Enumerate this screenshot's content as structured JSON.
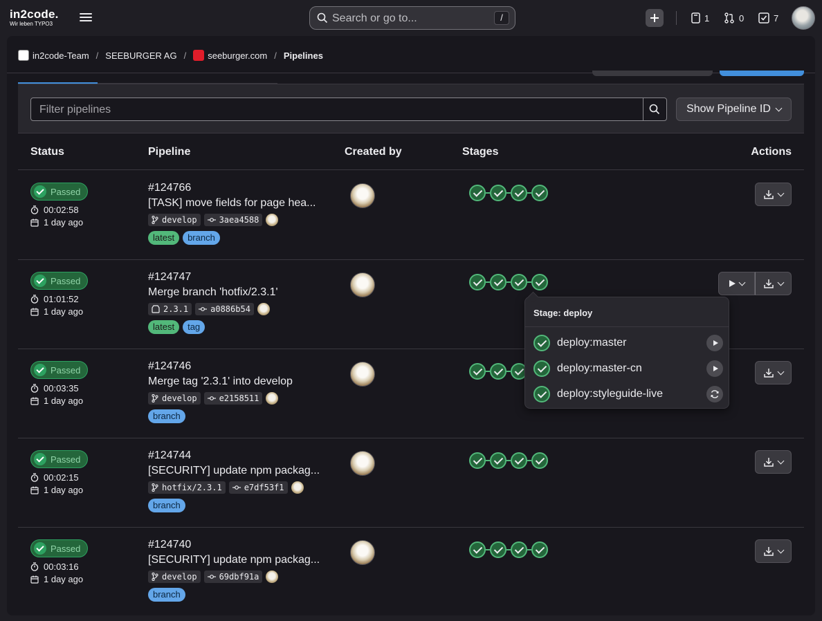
{
  "header": {
    "logo_main": "in2code.",
    "logo_sub": "Wir leben TYPO3",
    "search_placeholder": "Search or go to...",
    "search_shortcut": "/",
    "issues_count": "1",
    "merge_requests_count": "0",
    "todos_count": "7"
  },
  "breadcrumbs": [
    {
      "label": "in2code-Team",
      "icon_color": "#ffffff"
    },
    {
      "label": "SEEBURGER AG"
    },
    {
      "label": "seeburger.com",
      "icon_color": "#e11d2a"
    },
    {
      "label": "Pipelines"
    }
  ],
  "filter": {
    "placeholder": "Filter pipelines",
    "pipeline_id_button": "Show Pipeline ID"
  },
  "table": {
    "headers": [
      "Status",
      "Pipeline",
      "Created by",
      "Stages",
      "Actions"
    ]
  },
  "pipelines": [
    {
      "status": "Passed",
      "duration": "00:02:58",
      "finished": "1 day ago",
      "id": "#124766",
      "title": "[TASK] move fields for page hea...",
      "ref": "develop",
      "ref_type": "branch",
      "sha": "3aea4588",
      "tags": [
        "latest",
        "branch"
      ],
      "stages": 4,
      "play": false
    },
    {
      "status": "Passed",
      "duration": "01:01:52",
      "finished": "1 day ago",
      "id": "#124747",
      "title": "Merge branch 'hotfix/2.3.1'",
      "ref": "2.3.1",
      "ref_type": "tag",
      "sha": "a0886b54",
      "tags": [
        "latest",
        "tag"
      ],
      "stages": 4,
      "play": true
    },
    {
      "status": "Passed",
      "duration": "00:03:35",
      "finished": "1 day ago",
      "id": "#124746",
      "title": "Merge tag '2.3.1' into develop",
      "ref": "develop",
      "ref_type": "branch",
      "sha": "e2158511",
      "tags": [
        "branch"
      ],
      "stages": 4,
      "play": false
    },
    {
      "status": "Passed",
      "duration": "00:02:15",
      "finished": "1 day ago",
      "id": "#124744",
      "title": "[SECURITY] update npm packag...",
      "ref": "hotfix/2.3.1",
      "ref_type": "branch",
      "sha": "e7df53f1",
      "tags": [
        "branch"
      ],
      "stages": 4,
      "play": false
    },
    {
      "status": "Passed",
      "duration": "00:03:16",
      "finished": "1 day ago",
      "id": "#124740",
      "title": "[SECURITY] update npm packag...",
      "ref": "develop",
      "ref_type": "branch",
      "sha": "69dbf91a",
      "tags": [
        "branch"
      ],
      "stages": 4,
      "play": false
    }
  ],
  "popover": {
    "title": "Stage: deploy",
    "jobs": [
      {
        "name": "deploy:master",
        "action": "play"
      },
      {
        "name": "deploy:master-cn",
        "action": "play"
      },
      {
        "name": "deploy:styleguide-live",
        "action": "retry"
      }
    ]
  },
  "colors": {
    "success": "#2da160",
    "success_light": "#52b87a",
    "accent_blue": "#428fdc",
    "tag_blue": "#63a6e9"
  }
}
